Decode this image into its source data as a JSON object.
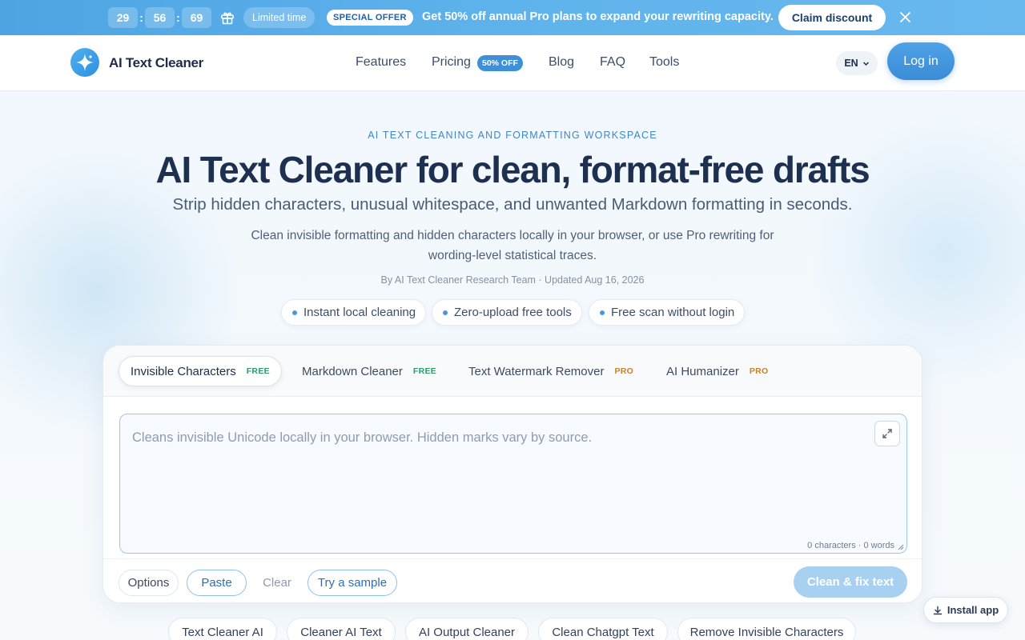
{
  "promo": {
    "timer": [
      "29",
      "56",
      "69"
    ],
    "timer_sep": ":",
    "limited": "Limited time",
    "special": "SPECIAL OFFER",
    "message": "Get 50% off annual Pro plans to expand your rewriting capacity.",
    "claim": "Claim discount",
    "icons": {
      "gift": "gift-icon",
      "close": "close-icon"
    }
  },
  "header": {
    "brand": "AI Text Cleaner",
    "nav": [
      "Features",
      "Pricing",
      "Blog",
      "FAQ",
      "Tools"
    ],
    "pricing_badge": "50% OFF",
    "lang": "EN",
    "login": "Log in"
  },
  "hero": {
    "eyebrow": "AI TEXT CLEANING AND FORMATTING WORKSPACE",
    "title": "AI Text Cleaner for clean, format-free drafts",
    "subtitle": "Strip hidden characters, unusual whitespace, and unwanted Markdown formatting in seconds.",
    "description": "Clean invisible formatting and hidden characters locally in your browser, or use Pro rewriting for wording-level statistical traces.",
    "byline": "By AI Text Cleaner Research Team · Updated Aug 16, 2026",
    "chips": [
      "Instant local cleaning",
      "Zero-upload free tools",
      "Free scan without login"
    ]
  },
  "tool": {
    "tabs": [
      {
        "label": "Invisible Characters",
        "badge": "FREE"
      },
      {
        "label": "Markdown Cleaner",
        "badge": "FREE"
      },
      {
        "label": "Text Watermark Remover",
        "badge": "PRO"
      },
      {
        "label": "AI Humanizer",
        "badge": "PRO"
      }
    ],
    "placeholder": "Cleans invisible Unicode locally in your browser. Hidden marks vary by source.",
    "counter": "0 characters · 0 words",
    "actions": {
      "options": "Options",
      "paste": "Paste",
      "clear": "Clear",
      "sample": "Try a sample"
    },
    "submit": "Clean & fix text"
  },
  "keywords": [
    "Text Cleaner AI",
    "Cleaner AI Text",
    "AI Output Cleaner",
    "Clean Chatgpt Text",
    "Remove Invisible Characters"
  ],
  "install": "Install app",
  "colors": {
    "accent": "#3f8fd8",
    "free": "#23a06b",
    "pro": "#c6812b"
  }
}
